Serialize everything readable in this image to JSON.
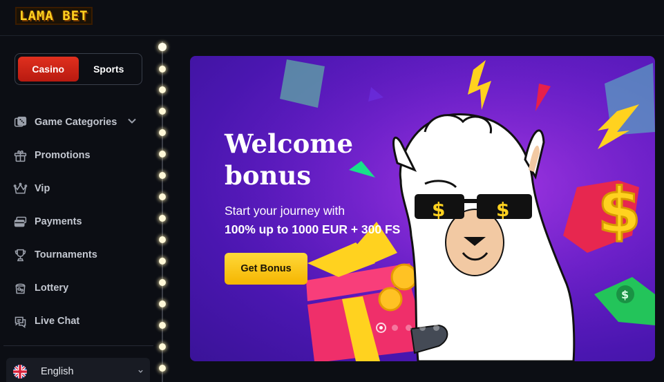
{
  "brand": {
    "logo_text": "LAMA BET"
  },
  "switcher": {
    "tabs": [
      {
        "label": "Casino",
        "active": true
      },
      {
        "label": "Sports",
        "active": false
      }
    ]
  },
  "nav": {
    "items": [
      {
        "label": "Game Categories",
        "icon": "dice-icon",
        "has_submenu": true
      },
      {
        "label": "Promotions",
        "icon": "gift-icon"
      },
      {
        "label": "Vip",
        "icon": "crown-icon"
      },
      {
        "label": "Payments",
        "icon": "wallet-icon"
      },
      {
        "label": "Tournaments",
        "icon": "trophy-icon"
      },
      {
        "label": "Lottery",
        "icon": "lottery-icon"
      },
      {
        "label": "Live Chat",
        "icon": "chat-icon"
      }
    ]
  },
  "language": {
    "label": "English",
    "flag": "uk-flag-icon"
  },
  "banner": {
    "title": "Welcome bonus",
    "line1": "Start your journey with",
    "line2": "100% up to 1000 EUR + 300 FS",
    "cta_label": "Get Bonus",
    "slides_total": 5,
    "active_slide": 1
  },
  "colors": {
    "accent_red": "#d9281a",
    "cta_yellow": "#ffcc1f",
    "banner_purple": "#6b1fc9",
    "background": "#0c0e14"
  }
}
